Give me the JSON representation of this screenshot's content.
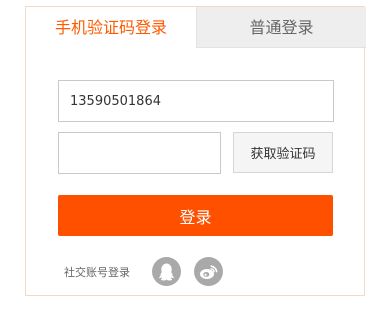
{
  "tabs": [
    {
      "label": "手机验证码登录",
      "active": true
    },
    {
      "label": "普通登录",
      "active": false
    }
  ],
  "form": {
    "phone_value": "13590501864",
    "phone_placeholder": "",
    "code_value": "",
    "code_placeholder": "",
    "get_code_label": "获取验证码",
    "login_label": "登录"
  },
  "social": {
    "label": "社交账号登录",
    "icons": [
      "qq-icon",
      "weibo-icon"
    ]
  },
  "colors": {
    "accent": "#ff5000",
    "active_tab_text": "#ff5a00",
    "inactive_tab_bg": "#eeeeee",
    "icon_gray": "#a9a9a9"
  }
}
